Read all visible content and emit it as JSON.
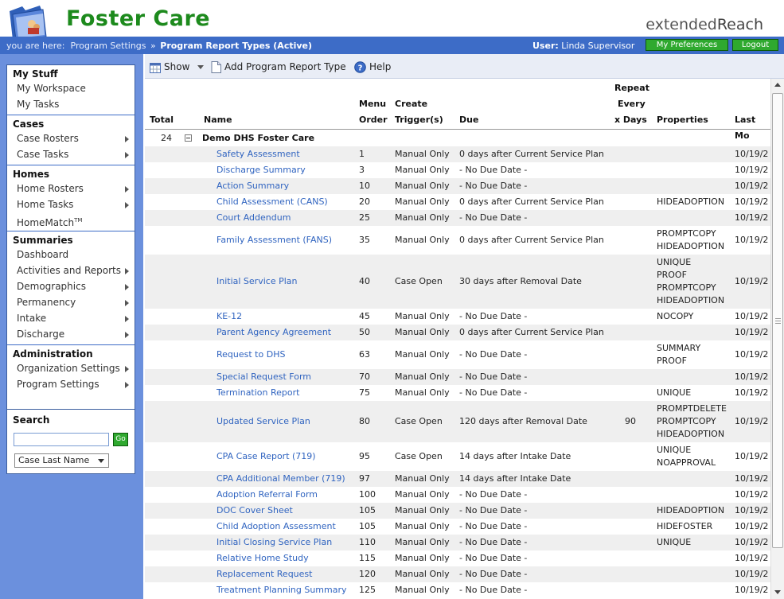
{
  "app": {
    "title": "Foster Care",
    "brand_light": "extended",
    "brand_bold": "Reach"
  },
  "breadcrumb": {
    "prefix": "you are here:",
    "parent": "Program Settings",
    "separator": "»",
    "current": "Program Report Types (Active)"
  },
  "user": {
    "label": "User:",
    "name": "Linda Supervisor"
  },
  "top_buttons": {
    "preferences": "My Preferences",
    "logout": "Logout"
  },
  "sidebar": {
    "sections": [
      {
        "title": "My Stuff",
        "items": [
          {
            "label": "My Workspace",
            "arrow": false
          },
          {
            "label": "My Tasks",
            "arrow": false
          }
        ]
      },
      {
        "title": "Cases",
        "items": [
          {
            "label": "Case Rosters",
            "arrow": true
          },
          {
            "label": "Case Tasks",
            "arrow": true
          }
        ]
      },
      {
        "title": "Homes",
        "items": [
          {
            "label": "Home Rosters",
            "arrow": true
          },
          {
            "label": "Home Tasks",
            "arrow": true
          },
          {
            "label": "HomeMatch",
            "sup": "TM",
            "arrow": false
          }
        ]
      },
      {
        "title": "Summaries",
        "items": [
          {
            "label": "Dashboard",
            "arrow": false
          },
          {
            "label": "Activities and Reports",
            "arrow": true
          },
          {
            "label": "Demographics",
            "arrow": true
          },
          {
            "label": "Permanency",
            "arrow": true
          },
          {
            "label": "Intake",
            "arrow": true
          },
          {
            "label": "Discharge",
            "arrow": true
          }
        ]
      },
      {
        "title": "Administration",
        "items": [
          {
            "label": "Organization Settings",
            "arrow": true
          },
          {
            "label": "Program Settings",
            "arrow": true
          }
        ]
      }
    ]
  },
  "search": {
    "title": "Search",
    "value": "",
    "go_label": "Go",
    "select_value": "Case Last Name"
  },
  "toolbar": {
    "show_label": "Show",
    "add_label": "Add Program Report Type",
    "help_label": "Help"
  },
  "grid": {
    "headers": {
      "total": "Total",
      "name": "Name",
      "menu_order_1": "Menu",
      "menu_order_2": "Order",
      "trigger_1": "Create",
      "trigger_2": "Trigger(s)",
      "due": "Due",
      "repeat_1": "Repeat",
      "repeat_2": "Every",
      "repeat_3": "x Days",
      "properties": "Properties",
      "last_modified": "Last Mo"
    },
    "group": {
      "total": "24",
      "name": "Demo DHS Foster Care"
    },
    "rows": [
      {
        "name": "Safety Assessment",
        "order": "1",
        "trigger": "Manual Only",
        "due": "0 days after Current Service Plan",
        "repeat": "",
        "props": [],
        "mod": "10/19/2"
      },
      {
        "name": "Discharge Summary",
        "order": "3",
        "trigger": "Manual Only",
        "due": "- No Due Date -",
        "repeat": "",
        "props": [],
        "mod": "10/19/2"
      },
      {
        "name": "Action Summary",
        "order": "10",
        "trigger": "Manual Only",
        "due": "- No Due Date -",
        "repeat": "",
        "props": [],
        "mod": "10/19/2"
      },
      {
        "name": "Child Assessment (CANS)",
        "order": "20",
        "trigger": "Manual Only",
        "due": "0 days after Current Service Plan",
        "repeat": "",
        "props": [
          "HIDEADOPTION"
        ],
        "mod": "10/19/2"
      },
      {
        "name": "Court Addendum",
        "order": "25",
        "trigger": "Manual Only",
        "due": "- No Due Date -",
        "repeat": "",
        "props": [],
        "mod": "10/19/2"
      },
      {
        "name": "Family Assessment (FANS)",
        "order": "35",
        "trigger": "Manual Only",
        "due": "0 days after Current Service Plan",
        "repeat": "",
        "props": [
          "PROMPTCOPY",
          "HIDEADOPTION"
        ],
        "mod": "10/19/2"
      },
      {
        "name": "Initial Service Plan",
        "order": "40",
        "trigger": "Case Open",
        "due": "30 days after Removal Date",
        "repeat": "",
        "props": [
          "UNIQUE",
          "PROOF",
          "PROMPTCOPY",
          "HIDEADOPTION"
        ],
        "mod": "10/19/2"
      },
      {
        "name": "KE-12",
        "order": "45",
        "trigger": "Manual Only",
        "due": "- No Due Date -",
        "repeat": "",
        "props": [
          "NOCOPY"
        ],
        "mod": "10/19/2"
      },
      {
        "name": "Parent Agency Agreement",
        "order": "50",
        "trigger": "Manual Only",
        "due": "0 days after Current Service Plan",
        "repeat": "",
        "props": [],
        "mod": "10/19/2"
      },
      {
        "name": "Request to DHS",
        "order": "63",
        "trigger": "Manual Only",
        "due": "- No Due Date -",
        "repeat": "",
        "props": [
          "SUMMARY",
          "PROOF"
        ],
        "mod": "10/19/2"
      },
      {
        "name": "Special Request Form",
        "order": "70",
        "trigger": "Manual Only",
        "due": "- No Due Date -",
        "repeat": "",
        "props": [],
        "mod": "10/19/2"
      },
      {
        "name": "Termination Report",
        "order": "75",
        "trigger": "Manual Only",
        "due": "- No Due Date -",
        "repeat": "",
        "props": [
          "UNIQUE"
        ],
        "mod": "10/19/2"
      },
      {
        "name": "Updated Service Plan",
        "order": "80",
        "trigger": "Case Open",
        "due": "120 days after Removal Date",
        "repeat": "90",
        "props": [
          "PROMPTDELETE",
          "PROMPTCOPY",
          "HIDEADOPTION"
        ],
        "mod": "10/19/2"
      },
      {
        "name": "CPA Case Report (719)",
        "order": "95",
        "trigger": "Case Open",
        "due": "14 days after Intake Date",
        "repeat": "",
        "props": [
          "UNIQUE",
          "NOAPPROVAL"
        ],
        "mod": "10/19/2"
      },
      {
        "name": "CPA Additional Member (719)",
        "order": "97",
        "trigger": "Manual Only",
        "due": "14 days after Intake Date",
        "repeat": "",
        "props": [],
        "mod": "10/19/2"
      },
      {
        "name": "Adoption Referral Form",
        "order": "100",
        "trigger": "Manual Only",
        "due": "- No Due Date -",
        "repeat": "",
        "props": [],
        "mod": "10/19/2"
      },
      {
        "name": "DOC Cover Sheet",
        "order": "105",
        "trigger": "Manual Only",
        "due": "- No Due Date -",
        "repeat": "",
        "props": [
          "HIDEADOPTION"
        ],
        "mod": "10/19/2"
      },
      {
        "name": "Child Adoption Assessment",
        "order": "105",
        "trigger": "Manual Only",
        "due": "- No Due Date -",
        "repeat": "",
        "props": [
          "HIDEFOSTER"
        ],
        "mod": "10/19/2"
      },
      {
        "name": "Initial Closing Service Plan",
        "order": "110",
        "trigger": "Manual Only",
        "due": "- No Due Date -",
        "repeat": "",
        "props": [
          "UNIQUE"
        ],
        "mod": "10/19/2"
      },
      {
        "name": "Relative Home Study",
        "order": "115",
        "trigger": "Manual Only",
        "due": "- No Due Date -",
        "repeat": "",
        "props": [],
        "mod": "10/19/2"
      },
      {
        "name": "Replacement Request",
        "order": "120",
        "trigger": "Manual Only",
        "due": "- No Due Date -",
        "repeat": "",
        "props": [],
        "mod": "10/19/2"
      },
      {
        "name": "Treatment Planning Summary",
        "order": "125",
        "trigger": "Manual Only",
        "due": "- No Due Date -",
        "repeat": "",
        "props": [],
        "mod": "10/19/2"
      }
    ]
  },
  "colors": {
    "brand_green": "#1d8a1d",
    "bar_blue": "#3d6cc7",
    "sidebar_blue": "#6b90dd",
    "link_blue": "#3064c0",
    "button_green": "#2fa92f"
  }
}
